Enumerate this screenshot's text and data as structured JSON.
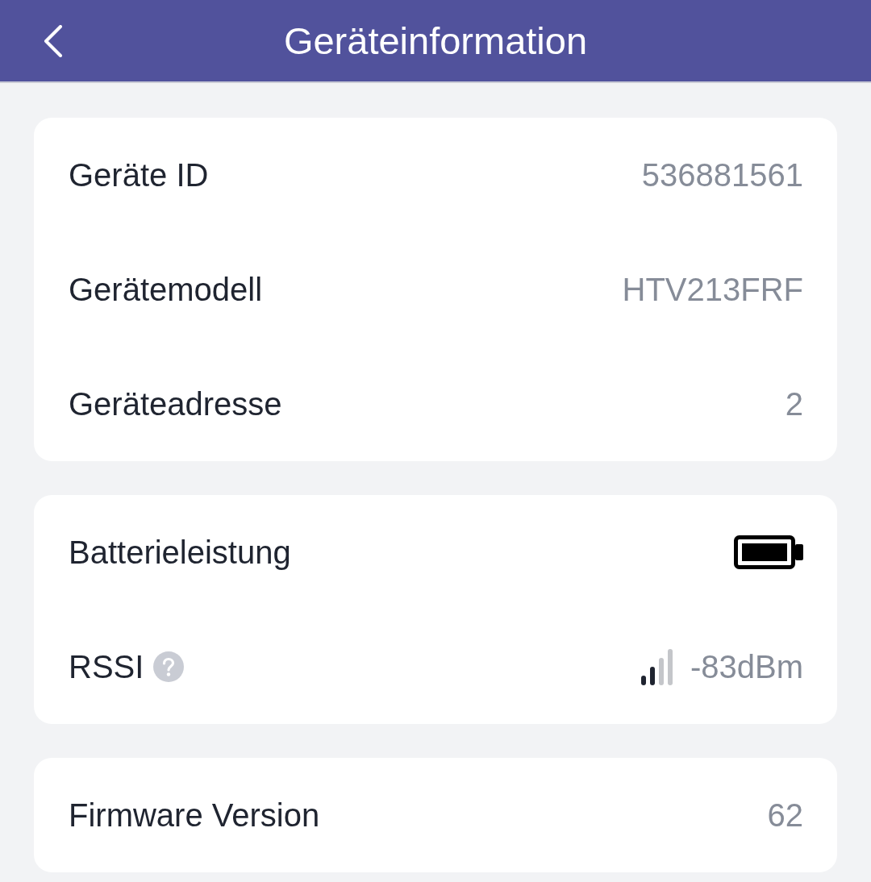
{
  "header": {
    "title": "Geräteinformation"
  },
  "sections": [
    {
      "rows": [
        {
          "kind": "text",
          "label": "Geräte ID",
          "value": "536881561",
          "help": false
        },
        {
          "kind": "text",
          "label": "Gerätemodell",
          "value": "HTV213FRF",
          "help": false
        },
        {
          "kind": "text",
          "label": "Geräteadresse",
          "value": "2",
          "help": false
        }
      ]
    },
    {
      "rows": [
        {
          "kind": "battery",
          "label": "Batterieleistung",
          "help": false
        },
        {
          "kind": "signal",
          "label": "RSSI",
          "value": "-83dBm",
          "help": true
        }
      ]
    },
    {
      "rows": [
        {
          "kind": "text",
          "label": "Firmware Version",
          "value": "62",
          "help": false
        }
      ]
    }
  ]
}
